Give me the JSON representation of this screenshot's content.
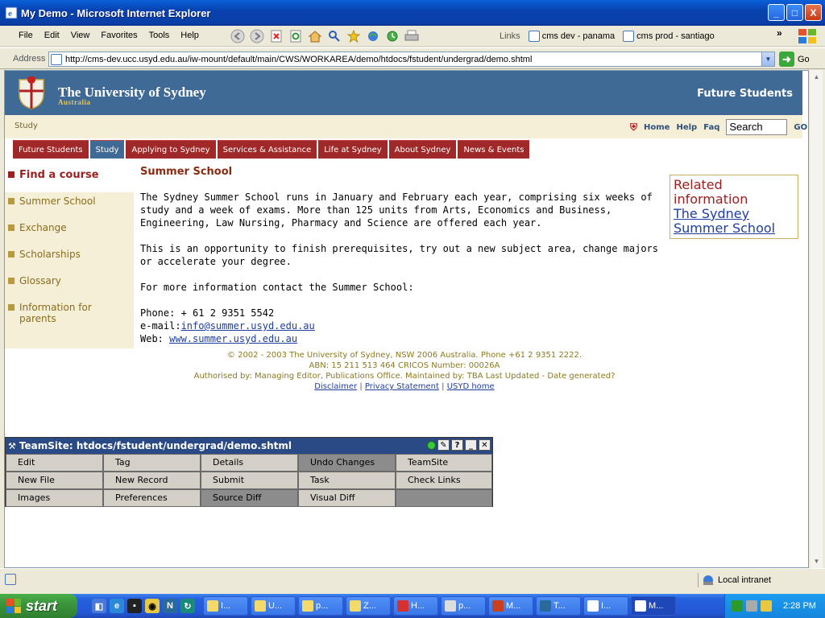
{
  "window": {
    "title": "My Demo - Microsoft Internet Explorer",
    "minimize": "_",
    "maximize": "□",
    "close": "X"
  },
  "menu": [
    "File",
    "Edit",
    "View",
    "Favorites",
    "Tools",
    "Help"
  ],
  "links_bar": {
    "label": "Links",
    "items": [
      "cms dev - panama",
      "cms prod - santiago"
    ]
  },
  "address": {
    "label": "Address",
    "url": "http://cms-dev.ucc.usyd.edu.au/iw-mount/default/main/CWS/WORKAREA/demo/htdocs/fstudent/undergrad/demo.shtml",
    "go": "Go"
  },
  "site": {
    "name": "The University of Sydney",
    "sub": "Australia",
    "section": "Future Students",
    "crumb": "Study",
    "util": {
      "home": "Home",
      "help": "Help",
      "faq": "Faq",
      "search_value": "Search",
      "go": "GO"
    },
    "tabs": [
      "Future Students",
      "Study",
      "Applying to Sydney",
      "Services & Assistance",
      "Life at Sydney",
      "About Sydney",
      "News & Events"
    ],
    "active_tab": "Study"
  },
  "leftnav": {
    "active": "Find a course",
    "items": [
      "Summer School",
      "Exchange",
      "Scholarships",
      "Glossary",
      "Information for parents"
    ]
  },
  "main": {
    "heading": "Summer School",
    "p1": "The Sydney Summer School runs in January and February each year, comprising six weeks of study and a week of exams. More than 125 units from Arts, Economics and Business, Engineering, Law Nursing, Pharmacy and Science are offered each year.",
    "p2": "This is an opportunity to finish prerequisites, try out a new subject area, change majors or accelerate your degree.",
    "p3": "For more information contact the Summer School:",
    "phone": "Phone: + 61 2 9351 5542",
    "email_label": "e-mail:",
    "email": "info@summer.usyd.edu.au",
    "web_label": "Web: ",
    "web": "www.summer.usyd.edu.au"
  },
  "related": {
    "heading": "Related information",
    "link": "The Sydney Summer School"
  },
  "footer": {
    "line1": "© 2002 - 2003 The University of Sydney, NSW 2006 Australia. Phone +61 2 9351 2222.",
    "line2": "ABN: 15 211 513 464 CRICOS Number: 00026A",
    "line3": "Authorised by: Managing Editor, Publications Office. Maintained by: TBA Last Updated - Date generated?",
    "links": [
      "Disclaimer",
      "Privacy Statement",
      "USYD home"
    ]
  },
  "teamsite": {
    "title": "TeamSite: htdocs/fstudent/undergrad/demo.shtml",
    "buttons": [
      "Edit",
      "Tag",
      "Details",
      "Undo Changes",
      "TeamSite",
      "New File",
      "New Record",
      "Submit",
      "Task",
      "Check Links",
      "Images",
      "Preferences",
      "Source Diff",
      "Visual Diff",
      ""
    ]
  },
  "status": {
    "zone": "Local intranet"
  },
  "taskbar": {
    "start": "start",
    "tasks": [
      "I...",
      "U...",
      "p...",
      "Z...",
      "H...",
      "p...",
      "M...",
      "T...",
      "I...",
      "M..."
    ],
    "clock": "2:28 PM"
  }
}
